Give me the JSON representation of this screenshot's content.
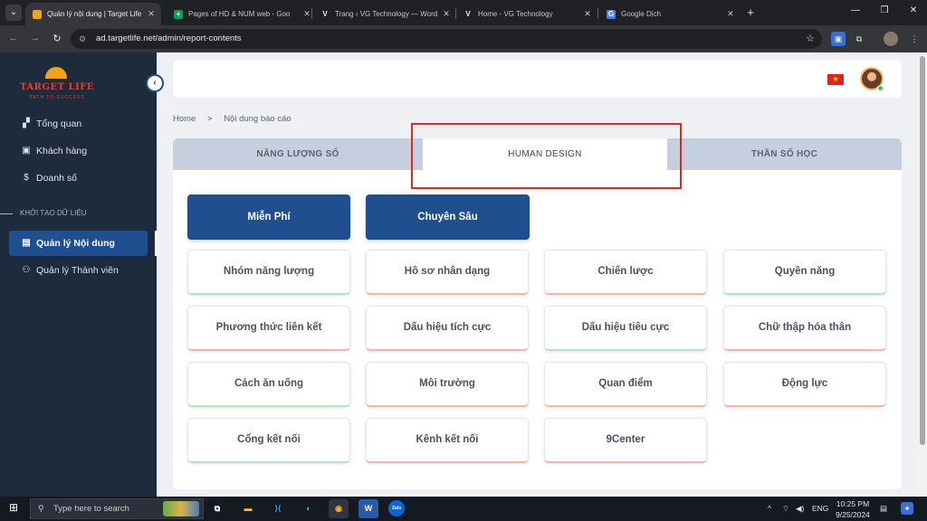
{
  "browser": {
    "tabs": [
      {
        "title": "Quản lý nội dung | Target Life",
        "favicon": "target-life-icon",
        "active": true
      },
      {
        "title": "Pages of HD & NUM web - Goo",
        "favicon": "sheets-icon",
        "active": false
      },
      {
        "title": "Trang ‹ VG Technology — Word",
        "favicon": "vg-icon",
        "active": false
      },
      {
        "title": "Home - VG Technology",
        "favicon": "vg-icon",
        "active": false
      },
      {
        "title": "Google Dịch",
        "favicon": "translate-icon",
        "active": false
      }
    ],
    "url": "ad.targetlife.net/admin/report-contents"
  },
  "sidebar": {
    "brand": "TARGET LIFE",
    "tagline": "PATH TO SUCCESS",
    "items": [
      {
        "label": "Tổng quan",
        "icon": "dashboard-icon"
      },
      {
        "label": "Khách hàng",
        "icon": "contact-card-icon"
      },
      {
        "label": "Doanh số",
        "icon": "dollar-icon"
      }
    ],
    "section_title": "KHỞI TẠO DỮ LIỆU",
    "items2": [
      {
        "label": "Quản lý Nội dung",
        "icon": "document-icon",
        "active": true
      },
      {
        "label": "Quản lý Thành viên",
        "icon": "users-icon",
        "active": false
      }
    ]
  },
  "breadcrumb": {
    "home": "Home",
    "separator": ">",
    "current": "Nội dung báo cáo"
  },
  "main_tabs": [
    {
      "label": "NĂNG LƯỢNG SỐ",
      "active": false
    },
    {
      "label": "HUMAN DESIGN",
      "active": true
    },
    {
      "label": "THẦN SỐ HỌC",
      "active": false
    }
  ],
  "primary_buttons": [
    {
      "label": "Miễn Phí"
    },
    {
      "label": "Chuyên Sâu"
    }
  ],
  "categories": [
    "Nhóm năng lượng",
    "Hồ sơ nhân dạng",
    "Chiến lược",
    "Quyền năng",
    "Phương thức liên kết",
    "Dấu hiệu tích cực",
    "Dấu hiệu tiêu cực",
    "Chữ thập hóa thân",
    "Cách ăn uống",
    "Môi trường",
    "Quan điểm",
    "Động lực",
    "Cổng kết nối",
    "Kênh kết nối",
    "9Center"
  ],
  "taskbar": {
    "search_placeholder": "Type here to search",
    "language": "ENG",
    "time": "10:25 PM",
    "date": "9/25/2024"
  },
  "colors": {
    "sidebar_bg": "#1e2b3c",
    "accent": "#1e4f8f",
    "highlight_box": "#d72b2b"
  }
}
